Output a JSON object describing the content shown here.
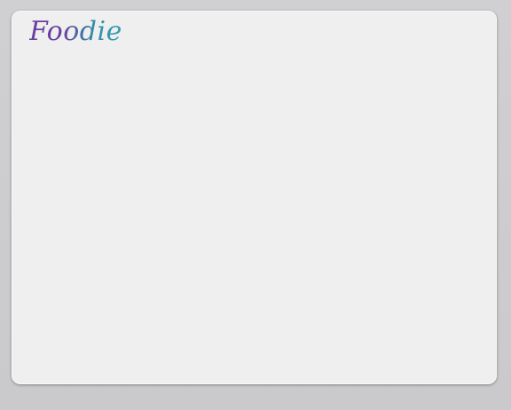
{
  "app": {
    "logo_text": "Foodie"
  },
  "colors": {
    "background": "#cfcfd1",
    "panel": "#efefef",
    "logo_purple": "#6a3fa0",
    "logo_teal": "#3a9fb5"
  }
}
